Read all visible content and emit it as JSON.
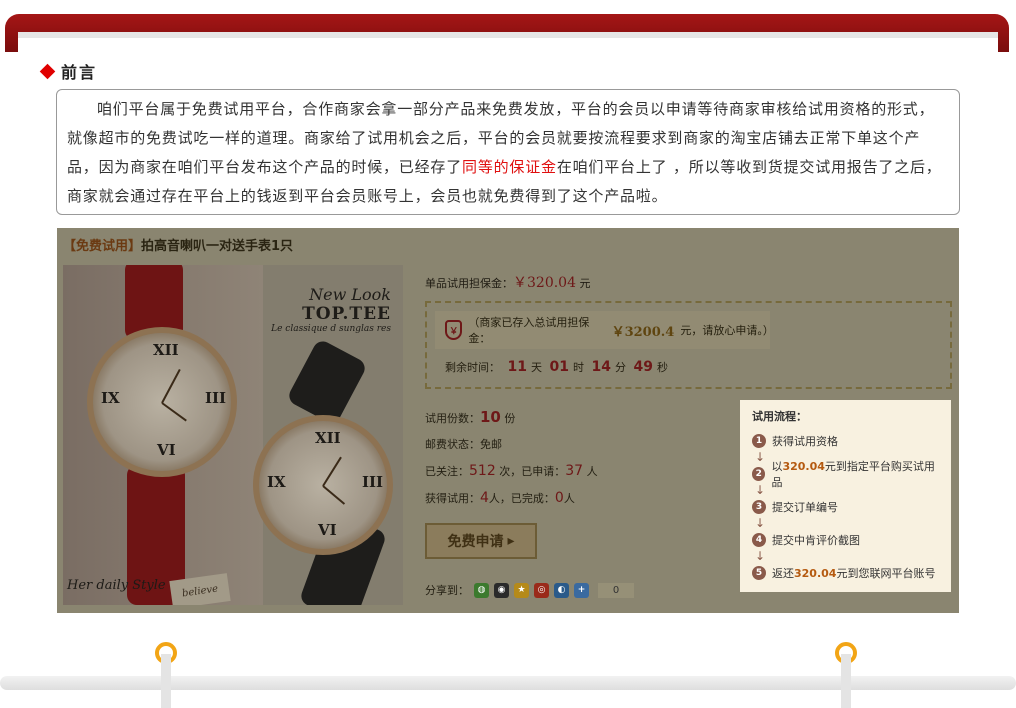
{
  "preface": {
    "title": "前言",
    "text_part1": "咱们平台属于免费试用平台，合作商家会拿一部分产品来免费发放，平台的会员以申请等待商家审核给试用资格的形式，就像超市的免费试吃一样的道理。商家给了试用机会之后，平台的会员就要按流程要求到商家的淘宝店铺去正常下单这个产品，因为商家在咱们平台发布这个产品的时候，已经存了",
    "highlight": "同等的保证金",
    "text_part2": "在咱们平台上了 ，所以等收到货提交试用报告了之后，商家就会通过存在平台上的钱返到平台会员账号上，会员也就免费得到了这个产品啦。"
  },
  "product": {
    "tag": "【免费试用】",
    "name": "拍高音喇叭一对送手表1只",
    "image": {
      "brand_line1": "New Look",
      "brand_line2": "TOP.TEE",
      "brand_line3": "Le classique d sunglas res",
      "style_text": "Her daily Style",
      "tag_text": "believe"
    },
    "guarantee_label": "单品试用担保金：",
    "guarantee_price": "￥320.04",
    "guarantee_unit": "元",
    "notice_prefix": "（商家已存入总试用担保金：",
    "notice_amount": "￥3200.4",
    "notice_suffix": "元，请放心申请。）",
    "shield_glyph": "￥",
    "countdown": {
      "label": "剩余时间：",
      "days": "11",
      "days_unit": "天",
      "hours": "01",
      "hours_unit": "时",
      "minutes": "14",
      "minutes_unit": "分",
      "seconds": "49",
      "seconds_unit": "秒"
    },
    "stats": {
      "copies_label": "试用份数：",
      "copies": "10",
      "copies_unit": "份",
      "shipping_label": "邮费状态：",
      "shipping": "免邮",
      "follow_label": "已关注：",
      "follow": "512",
      "follow_unit": "次，已申请：",
      "applied": "37",
      "applied_unit": "人",
      "got_label": "获得试用：",
      "got": "4",
      "got_unit": "人，已完成：",
      "done": "0",
      "done_unit": "人"
    },
    "apply_button": "免费申请",
    "apply_arrow": "▸",
    "share_label": "分享到：",
    "share_count": "0"
  },
  "process": {
    "title": "试用流程：",
    "arrow": "↓",
    "steps": [
      {
        "n": "1",
        "text": "获得试用资格"
      },
      {
        "n": "2",
        "pre": "以",
        "hl": "320.04",
        "post": "元到指定平台购买试用品"
      },
      {
        "n": "3",
        "text": "提交订单编号"
      },
      {
        "n": "4",
        "text": "提交中肯评价截图"
      },
      {
        "n": "5",
        "pre": "返还",
        "hl": "320.04",
        "post": "元到您联网平台账号"
      }
    ]
  },
  "colors": {
    "banner": "#a51616",
    "highlight": "#e01010",
    "overlay": "#8a8570",
    "peg_ring": "#f2a516"
  }
}
